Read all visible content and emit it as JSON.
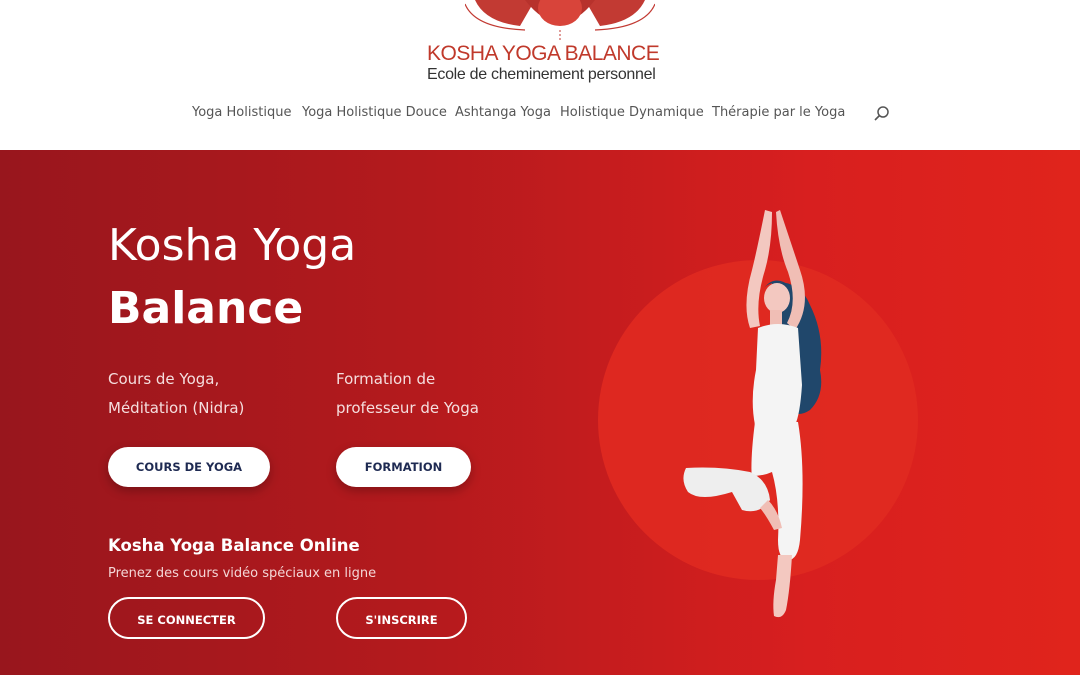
{
  "logo": {
    "title": "KOSHA YOGA BALANCE",
    "subtitle": "Ecole de cheminement personnel",
    "colors": {
      "brand": "#c0392b",
      "dark": "#333333"
    }
  },
  "nav": {
    "items": [
      {
        "label": "Yoga Holistique"
      },
      {
        "label": "Yoga Holistique Douce"
      },
      {
        "label": "Ashtanga Yoga"
      },
      {
        "label": "Holistique Dynamique"
      },
      {
        "label": "Thérapie par le Yoga"
      }
    ],
    "search_icon": "search-icon"
  },
  "hero": {
    "title_line1": "Kosha Yoga",
    "title_line2": "Balance",
    "col1_line1": "Cours de Yoga,",
    "col1_line2": "Méditation (Nidra)",
    "col2_line1": "Formation de",
    "col2_line2": "professeur de Yoga",
    "btn_cours": "COURS DE YOGA",
    "btn_formation": "FORMATION",
    "online_title": "Kosha Yoga Balance Online",
    "online_sub": "Prenez des cours vidéo spéciaux en ligne",
    "btn_connect": "SE CONNECTER",
    "btn_signup": "S'INSCRIRE",
    "illustration": "yoga-tree-pose-illustration",
    "colors": {
      "gradient_start": "#98161d",
      "gradient_end": "#e0241c",
      "button_text": "#1e2a52"
    }
  }
}
